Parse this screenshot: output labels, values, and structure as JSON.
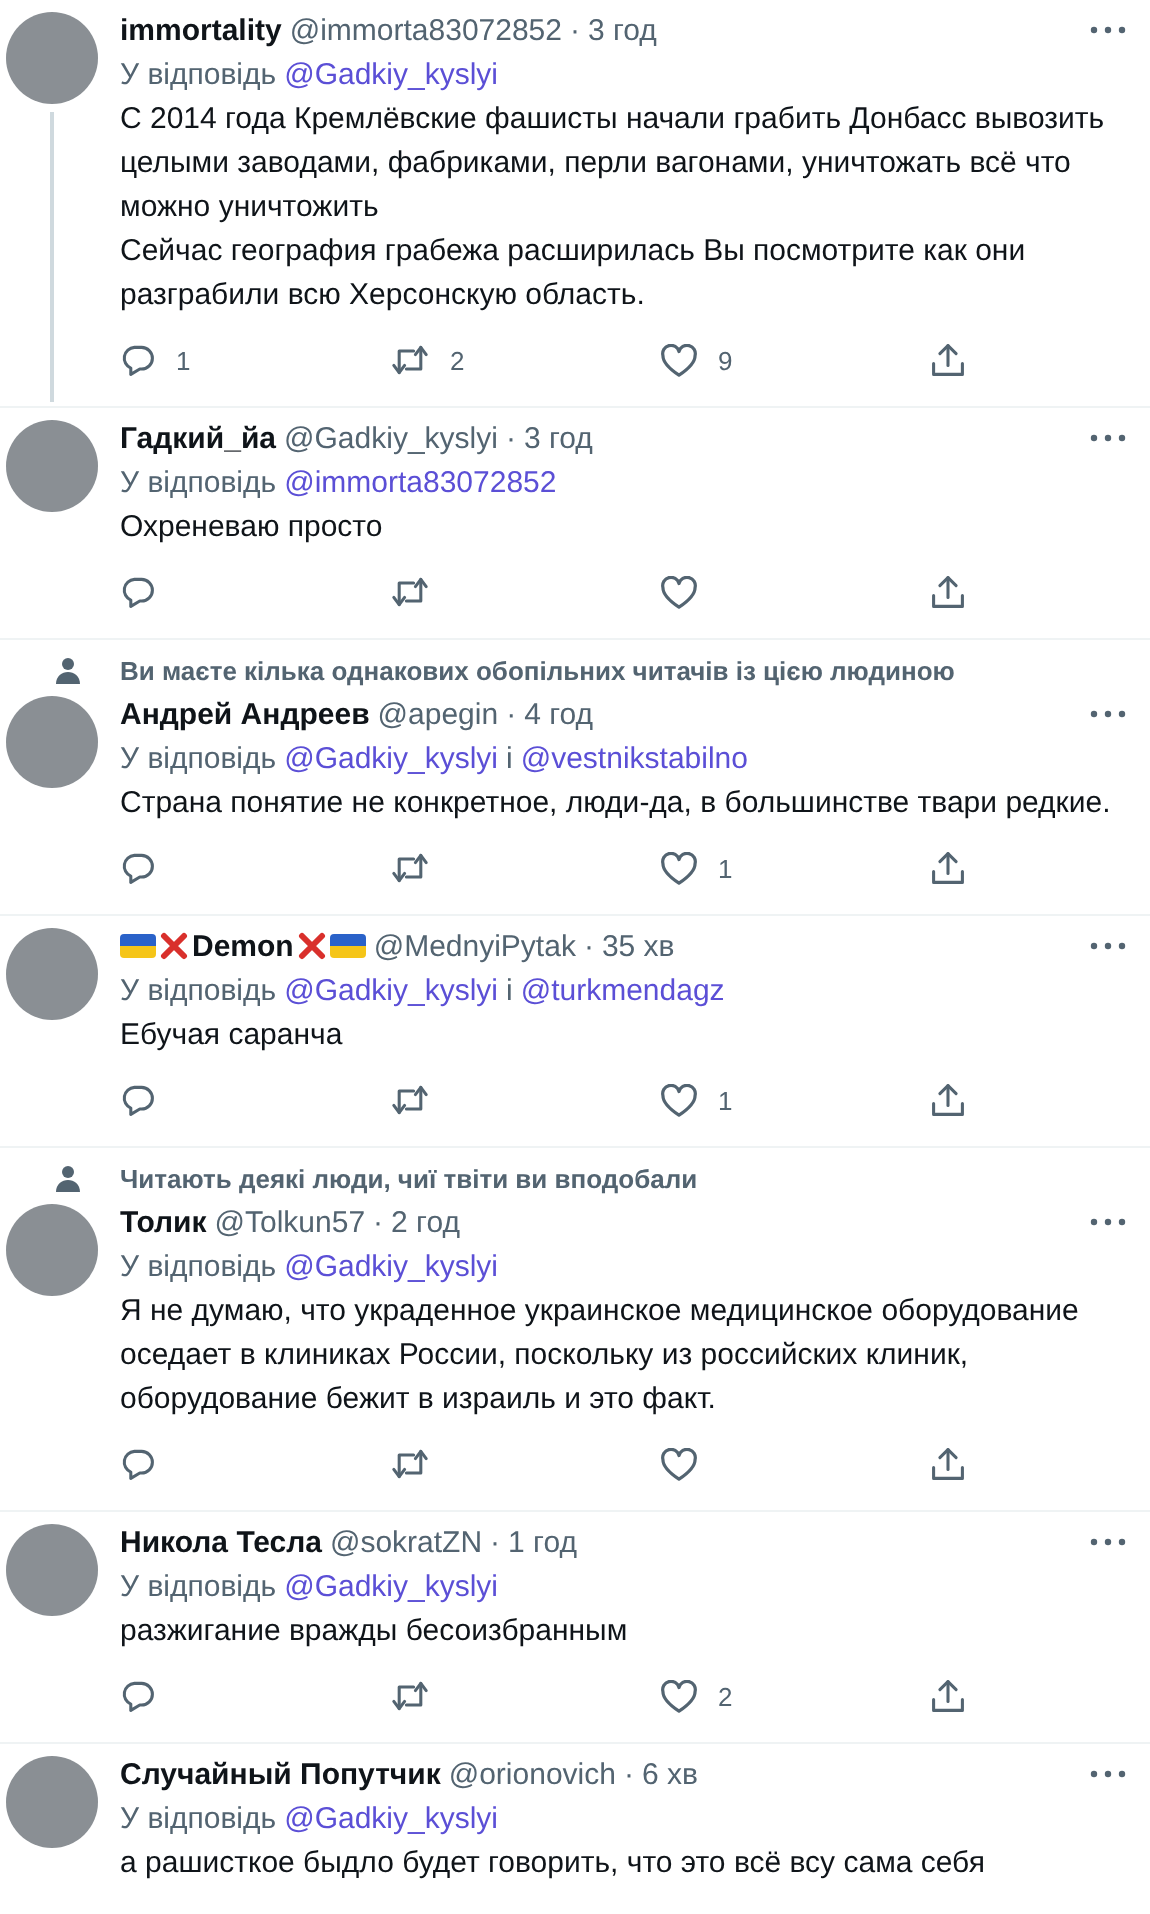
{
  "tweets": [
    {
      "name_parts": [
        {
          "kind": "text",
          "text": "immortality"
        }
      ],
      "handle": "@immorta83072852",
      "separator": "·",
      "time": "3 год",
      "reply": {
        "label": "У відповідь",
        "handles": [
          "@Gadkiy_kyslyi"
        ]
      },
      "text": "С 2014 года Кремлёвские фашисты начали грабить Донбасс вывозить целыми заводами, фабриками, перли вагонами, уничтожать всё что можно уничтожить\nСейчас география грабежа расширилась Вы посмотрите как они разграбили всю Херсонскую область.",
      "thread_line": true,
      "replies": "1",
      "retweets": "2",
      "likes": "9"
    },
    {
      "name_parts": [
        {
          "kind": "text",
          "text": "Гадкий_йа"
        }
      ],
      "handle": "@Gadkiy_kyslyi",
      "separator": "·",
      "time": "3 год",
      "reply": {
        "label": "У відповідь",
        "handles": [
          "@immorta83072852"
        ]
      },
      "text": "Охреневаю просто"
    },
    {
      "social_context": "Ви маєте кілька однакових обопільних читачів із цією людиною",
      "name_parts": [
        {
          "kind": "text",
          "text": "Андрей Андреев"
        }
      ],
      "handle": "@apegin",
      "separator": "·",
      "time": "4 год",
      "reply": {
        "label": "У відповідь",
        "joiner": "і",
        "handles": [
          "@Gadkiy_kyslyi",
          "@vestnikstabilno"
        ]
      },
      "text": "Страна понятие не конкретное, люди-да, в большинстве твари редкие.",
      "likes": "1"
    },
    {
      "name_parts": [
        {
          "kind": "flag"
        },
        {
          "kind": "cross"
        },
        {
          "kind": "text",
          "text": "Demon"
        },
        {
          "kind": "cross"
        },
        {
          "kind": "flag"
        }
      ],
      "handle": "@MednyiPytak",
      "separator": "·",
      "time": "35 хв",
      "reply": {
        "label": "У відповідь",
        "joiner": "і",
        "handles": [
          "@Gadkiy_kyslyi",
          "@turkmendagz"
        ]
      },
      "text": "Ебучая саранча",
      "likes": "1"
    },
    {
      "social_context": "Читають деякі люди, чиї твіти ви вподобали",
      "name_parts": [
        {
          "kind": "text",
          "text": "Толик"
        }
      ],
      "handle": "@Tolkun57",
      "separator": "·",
      "time": "2 год",
      "reply": {
        "label": "У відповідь",
        "handles": [
          "@Gadkiy_kyslyi"
        ]
      },
      "text": "Я не думаю, что украденное украинское медицинское оборудование оседает в клиниках России, поскольку из российских клиник, оборудование бежит в израиль и это факт."
    },
    {
      "name_parts": [
        {
          "kind": "text",
          "text": "Никола Тесла"
        }
      ],
      "handle": "@sokratZN",
      "separator": "·",
      "time": "1 год",
      "reply": {
        "label": "У відповідь",
        "handles": [
          "@Gadkiy_kyslyi"
        ]
      },
      "text": "разжигание вражды бесоизбранным",
      "likes": "2"
    },
    {
      "name_parts": [
        {
          "kind": "text",
          "text": "Случайный Попутчик"
        }
      ],
      "handle": "@orionovich",
      "separator": "·",
      "time": "6 хв",
      "reply": {
        "label": "У відповідь",
        "handles": [
          "@Gadkiy_kyslyi"
        ]
      },
      "text": "а рашисткое быдло будет говорить, что это всё всу сама себя",
      "cut": true
    }
  ]
}
